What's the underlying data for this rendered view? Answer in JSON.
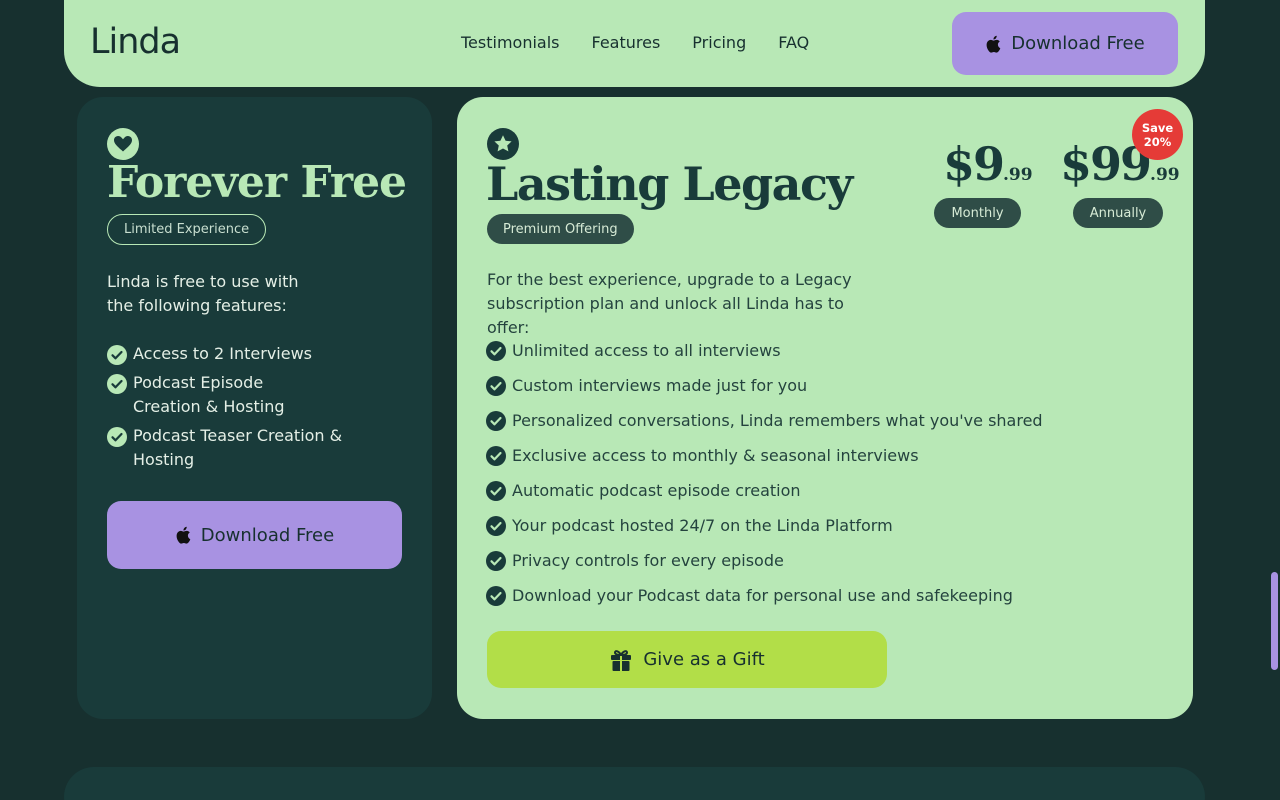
{
  "nav": {
    "logo": "Linda",
    "links": [
      "Testimonials",
      "Features",
      "Pricing",
      "FAQ"
    ],
    "download_label": "Download Free"
  },
  "free": {
    "title": "Forever Free",
    "tag": "Limited Experience",
    "intro_line1": "Linda is free to use with",
    "intro_line2": "the following features:",
    "features": [
      {
        "line1": "Access to 2 Interviews",
        "line2": ""
      },
      {
        "line1": "Podcast Episode",
        "line2": "Creation & Hosting"
      },
      {
        "line1": "Podcast Teaser Creation & Hosting",
        "line2": ""
      }
    ],
    "download_label": "Download Free"
  },
  "legacy": {
    "title": "Lasting Legacy",
    "tag": "Premium Offering",
    "monthly": {
      "dollars": "$9",
      "cents": ".99",
      "label": "Monthly"
    },
    "annual": {
      "dollars": "$99",
      "cents": ".99",
      "label": "Annually"
    },
    "save_line1": "Save",
    "save_line2": "20%",
    "intro_line1": "For the best experience, upgrade to a Legacy",
    "intro_line2": "subscription plan and unlock all Linda has to offer:",
    "features": [
      "Unlimited access to all interviews",
      "Custom interviews made just for you",
      "Personalized conversations, Linda remembers what you've shared",
      "Exclusive access to monthly & seasonal interviews",
      "Automatic podcast episode creation",
      "Your podcast hosted 24/7 on the Linda Platform",
      "Privacy controls for every episode",
      "Download your Podcast data for personal use and safekeeping"
    ],
    "gift_label": "Give as a Gift"
  },
  "colors": {
    "background": "#17302f",
    "mint": "#b8e8b6",
    "purple": "#a892e2",
    "lime": "#b2de48",
    "card_dark": "#193b3a",
    "save_red": "#e53b37"
  }
}
